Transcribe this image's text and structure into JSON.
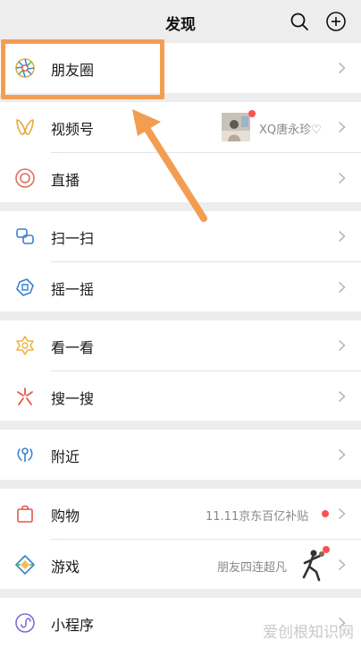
{
  "header": {
    "title": "发现",
    "search_icon": "search-icon",
    "add_icon": "plus-circle-icon"
  },
  "items": {
    "moments": {
      "label": "朋友圈",
      "icon": "camera-aperture-icon"
    },
    "channels": {
      "label": "视频号",
      "icon": "butterfly-icon",
      "sub": "XQ唐永珍♡"
    },
    "live": {
      "label": "直播",
      "icon": "live-ring-icon"
    },
    "scan": {
      "label": "扫一扫",
      "icon": "scan-icon"
    },
    "shake": {
      "label": "摇一摇",
      "icon": "shake-icon"
    },
    "top_stories": {
      "label": "看一看",
      "icon": "star-flower-icon"
    },
    "search": {
      "label": "搜一搜",
      "icon": "search-sparkle-icon"
    },
    "nearby": {
      "label": "附近",
      "icon": "location-icon"
    },
    "shopping": {
      "label": "购物",
      "icon": "shopping-bag-icon",
      "sub": "11.11京东百亿补贴"
    },
    "games": {
      "label": "游戏",
      "icon": "game-diamond-icon",
      "sub": "朋友四连超凡"
    },
    "mini_programs": {
      "label": "小程序",
      "icon": "mini-program-icon"
    }
  },
  "watermark": "爱创根知识网",
  "colors": {
    "accent_highlight": "#f29d52",
    "badge_red": "#fa5151",
    "background": "#ededed"
  }
}
